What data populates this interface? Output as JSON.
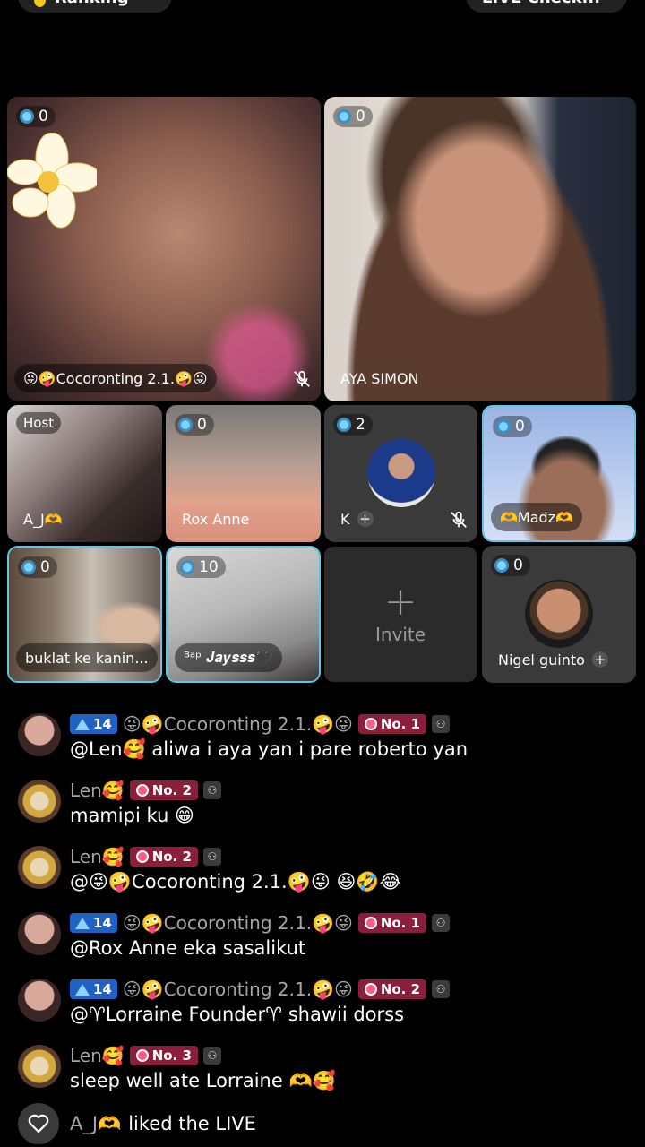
{
  "top": {
    "left_pill": "Daily Ranking",
    "right_pill": "LIVE Check..."
  },
  "tiles": {
    "t1": {
      "count": "0",
      "name": "😜🤪Cocoronting 2.1.🤪😜"
    },
    "t2": {
      "count": "0",
      "name": "AYA SIMON"
    },
    "t3": {
      "host": "Host",
      "name": "A_J🫶"
    },
    "t4": {
      "count": "0",
      "name": "Rox Anne"
    },
    "t5": {
      "count": "2",
      "name": "K"
    },
    "t6": {
      "count": "0",
      "name": "🫶Madz🫶"
    },
    "t7": {
      "count": "0",
      "name": "buklat ke kanin..."
    },
    "t8": {
      "count": "10",
      "name": "ᴮᵃᵖ 𝑱𝒂𝒚𝒔𝒔𝒔🖤"
    },
    "invite": "Invite",
    "t10": {
      "count": "0",
      "name": "Nigel guinto"
    }
  },
  "chat": [
    {
      "level": "14",
      "user": "😜🤪Cocoronting 2.1.🤪😜",
      "rank": "No. 1",
      "text": "@Len🥰 aliwa i aya yan i pare roberto yan"
    },
    {
      "user": "Len🥰",
      "rank": "No. 2",
      "text": "mamipi ku 😁"
    },
    {
      "user": "Len🥰",
      "rank": "No. 2",
      "text": "@😜🤪Cocoronting 2.1.🤪😜  😆🤣😂"
    },
    {
      "level": "14",
      "user": "😜🤪Cocoronting 2.1.🤪😜",
      "rank": "No. 1",
      "text": "@Rox Anne eka sasalikut"
    },
    {
      "level": "14",
      "user": "😜🤪Cocoronting 2.1.🤪😜",
      "rank": "No. 2",
      "text": "@♈Lorraine Founder♈ shawii dorss"
    },
    {
      "user": "Len🥰",
      "rank": "No. 3",
      "text": "sleep well ate Lorraine 🫶🥰"
    }
  ],
  "liked": {
    "user": "A_J🫶",
    "action": "liked the LIVE"
  },
  "colors": {
    "level_badge": "#1e62c6",
    "rank_badge": "#8b1e3b",
    "selected_border": "#5ac8e8"
  }
}
